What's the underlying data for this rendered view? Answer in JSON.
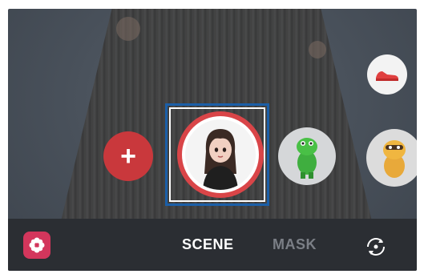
{
  "bottom_bar": {
    "modes": [
      "SCENE",
      "MASK"
    ],
    "selected_mode": "SCENE"
  },
  "icons": {
    "add": "plus-icon",
    "sticker": "flower-sticker-icon",
    "switch_camera": "switch-camera-icon",
    "sneaker": "sneaker-icon"
  },
  "colors": {
    "accent_red": "#d94548",
    "selection_blue": "#1b5fa8",
    "sticker_pink": "#d3365c"
  }
}
